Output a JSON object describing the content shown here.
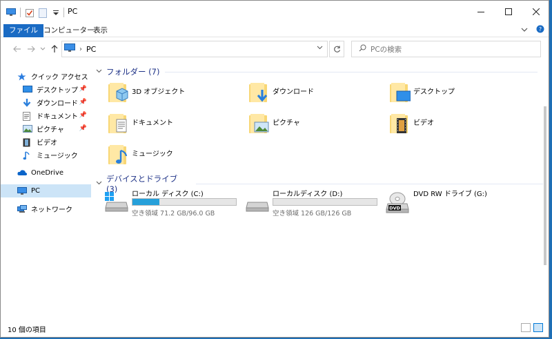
{
  "window": {
    "title": "PC"
  },
  "ribbon": {
    "tabs": [
      "ファイル",
      "コンピューター",
      "表示"
    ]
  },
  "address": {
    "crumb": "PC"
  },
  "search": {
    "placeholder": "PCの検索"
  },
  "nav": {
    "quick_access": "クイック アクセス",
    "items": [
      "デスクトップ",
      "ダウンロード",
      "ドキュメント",
      "ピクチャ",
      "ビデオ",
      "ミュージック"
    ],
    "onedrive": "OneDrive",
    "pc": "PC",
    "network": "ネットワーク"
  },
  "folders": {
    "header": "フォルダー (7)",
    "items": [
      "3D オブジェクト",
      "ダウンロード",
      "デスクトップ",
      "ドキュメント",
      "ピクチャ",
      "ビデオ",
      "ミュージック"
    ]
  },
  "drives": {
    "header": "デバイスとドライブ (3)",
    "items": [
      {
        "label": "ローカル ディスク (C:)",
        "free": "空き領域 71.2 GB/96.0 GB",
        "used_fraction": 0.26
      },
      {
        "label": "ローカルディスク (D:)",
        "free": "空き領域 126 GB/126 GB",
        "used_fraction": 0.0
      },
      {
        "label": "DVD RW ドライブ (G:)"
      }
    ]
  },
  "status": {
    "count": "10 個の項目"
  },
  "colors": {
    "accent": "#1a6bc4",
    "selection": "#cce4f7",
    "group_header": "#1e3287",
    "drive_fill": "#26a0da"
  }
}
